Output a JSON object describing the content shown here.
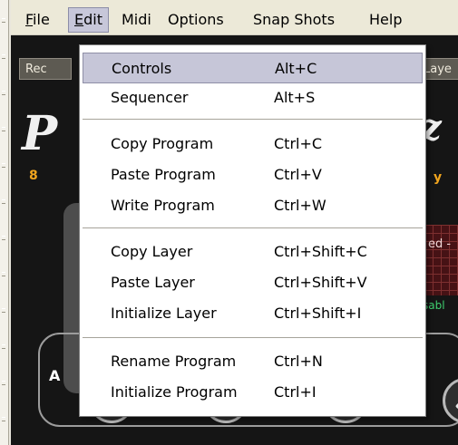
{
  "menubar": {
    "items": [
      {
        "label": "File",
        "mnemonic": "F",
        "rest": "ile"
      },
      {
        "label": "Edit",
        "mnemonic": "E",
        "rest": "dit"
      },
      {
        "label": "Midi"
      },
      {
        "label": "Options"
      },
      {
        "label": "Snap Shots"
      },
      {
        "label": "Help"
      }
    ],
    "active_item": "Edit"
  },
  "background": {
    "tab_left_label": "Rec",
    "tab_right_label": "Laye",
    "digit_left": "8",
    "digit_right": "y",
    "red_panel_text": "ed -",
    "green_text": "sabl",
    "lower_section_letter": "A"
  },
  "edit_menu": {
    "items": [
      {
        "label": "Controls",
        "shortcut": "Alt+C",
        "highlighted": true
      },
      {
        "label": "Sequencer",
        "shortcut": "Alt+S"
      },
      {
        "label": "Copy Program",
        "shortcut": "Ctrl+C"
      },
      {
        "label": "Paste Program",
        "shortcut": "Ctrl+V"
      },
      {
        "label": "Write Program",
        "shortcut": "Ctrl+W"
      },
      {
        "label": "Copy Layer",
        "shortcut": "Ctrl+Shift+C"
      },
      {
        "label": "Paste Layer",
        "shortcut": "Ctrl+Shift+V"
      },
      {
        "label": "Initialize Layer",
        "shortcut": "Ctrl+Shift+I"
      },
      {
        "label": "Rename Program",
        "shortcut": "Ctrl+N"
      },
      {
        "label": "Initialize Program",
        "shortcut": "Ctrl+I"
      }
    ]
  },
  "colors": {
    "menu_highlight": "#c6c6d8",
    "menubar_bg": "#ece9d8",
    "app_bg": "#151515",
    "accent_orange": "#f1a51e"
  }
}
